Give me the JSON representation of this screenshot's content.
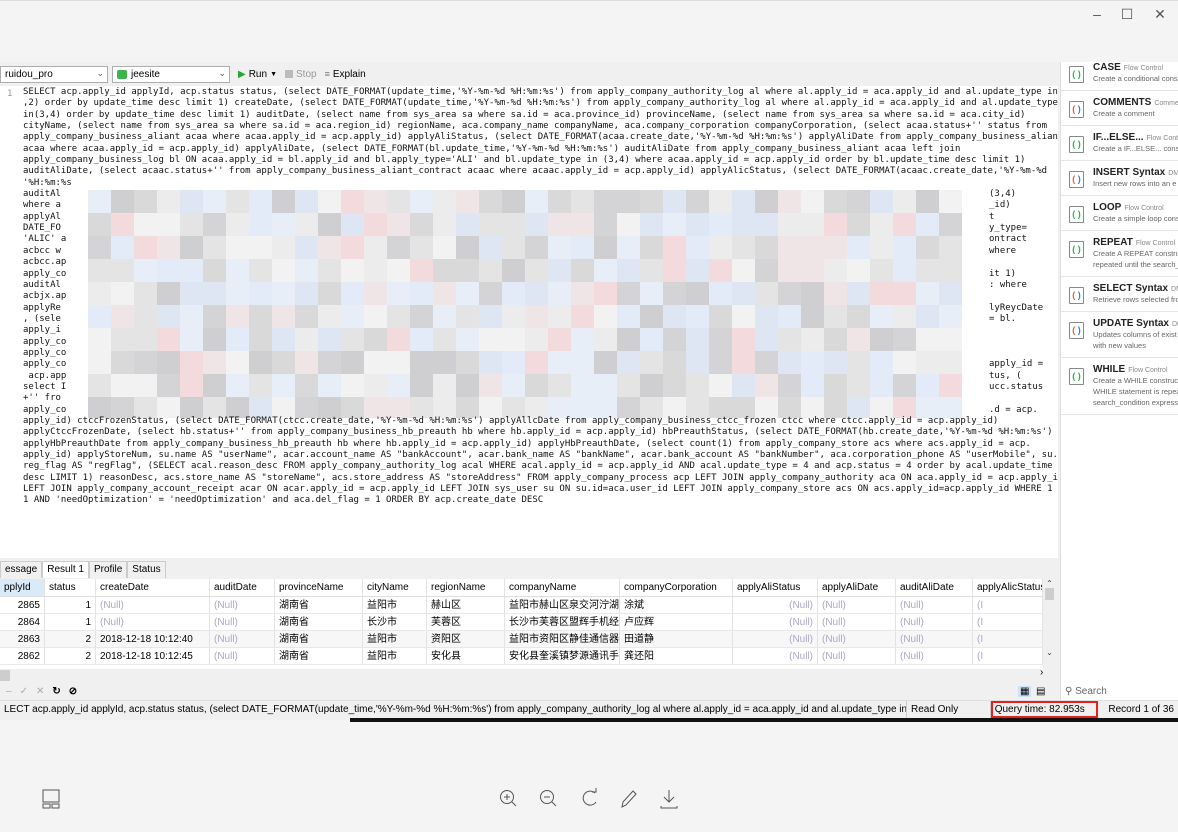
{
  "window": {
    "controls": [
      "minimize",
      "maximize",
      "close"
    ]
  },
  "toolbar": {
    "connection": "ruidou_pro",
    "database": "jeesite",
    "run": "Run",
    "stop": "Stop",
    "explain": "Explain"
  },
  "editor": {
    "line_number": "1",
    "full_lines_top": [
      "SELECT acp.apply_id applyId, acp.status status, (select DATE_FORMAT(update_time,'%Y-%m-%d %H:%m:%s') from apply_company_authority_log al where al.apply_id = aca.apply_id and al.update_type in(1",
      ",2) order by update_time desc limit 1) createDate, (select DATE_FORMAT(update_time,'%Y-%m-%d %H:%m:%s') from apply_company_authority_log al where al.apply_id = aca.apply_id and al.update_type",
      "in(3,4) order by update_time desc limit 1) auditDate, (select name from sys_area sa where sa.id = aca.province_id) provinceName, (select name from sys_area sa where sa.id = aca.city_id)",
      "cityName, (select name from sys_area sa where sa.id = aca.region_id) regionName, aca.company_name companyName, aca.company_corporation companyCorporation, (select acaa.status+'' status from",
      "apply_company_business_aliant acaa where acaa.apply_id = acp.apply_id) applyAliStatus, (select DATE_FORMAT(acaa.create_date,'%Y-%m-%d %H:%m:%s') applyAliDate from apply_company_business_aliant",
      "acaa where acaa.apply_id = acp.apply_id) applyAliDate, (select DATE_FORMAT(bl.update_time,'%Y-%m-%d %H:%m:%s') auditAliDate from apply_company_business_aliant acaa left join",
      "apply_company_business_log bl ON acaa.apply_id = bl.apply_id and bl.apply_type='ALI' and bl.update_type in (3,4) where acaa.apply_id = acp.apply_id order by bl.update_time desc limit 1)",
      "auditAliDate, (select acaac.status+'' from apply_company_business_aliant_contract acaac where acaac.apply_id = acp.apply_id) applyAlicStatus, (select DATE_FORMAT(acaac.create_date,'%Y-%m-%d"
    ],
    "blurred_lines": [
      {
        "left": "'%H:%m:%s",
        "right": ""
      },
      {
        "left": "auditAl",
        "right": "(3,4)"
      },
      {
        "left": "where a",
        "right": "_id)"
      },
      {
        "left": "applyAl",
        "right": "t"
      },
      {
        "left": "DATE_FO",
        "right": "y_type="
      },
      {
        "left": "'ALIC' a",
        "right": "ontract"
      },
      {
        "left": "acbcc w",
        "right": "where"
      },
      {
        "left": "acbcc.ap",
        "right": ""
      },
      {
        "left": "apply_co",
        "right": "it 1)"
      },
      {
        "left": "auditAl",
        "right": ": where"
      },
      {
        "left": "acbjx.ap",
        "right": ""
      },
      {
        "left": "applyRe",
        "right": "lyReycDate"
      },
      {
        "left": ", (sele",
        "right": "= bl."
      },
      {
        "left": "apply_i",
        "right": ""
      },
      {
        "left": "apply_co",
        "right": ""
      },
      {
        "left": "apply_co",
        "right": ""
      },
      {
        "left": "apply_co",
        "right": "apply_id ="
      },
      {
        "left": " acp.app",
        "right": "tus, ("
      },
      {
        "left": "select I",
        "right": "ucc.status"
      },
      {
        "left": "+'' fro",
        "right": ""
      },
      {
        "left": "apply_co",
        "right": ".d = acp."
      }
    ],
    "full_lines_bottom": [
      "apply_id) ctccFrozenStatus, (select DATE_FORMAT(ctcc.create_date,'%Y-%m-%d %H:%m:%s') applyAllcDate from apply_company_business_ctcc_frozen ctcc where ctcc.apply_id = acp.apply_id)",
      "applyCtccFrozenDate, (select hb.status+'' from apply_company_business_hb_preauth hb where hb.apply_id = acp.apply_id) hbPreauthStatus, (select DATE_FORMAT(hb.create_date,'%Y-%m-%d %H:%m:%s')",
      "applyHbPreauthDate from apply_company_business_hb_preauth hb where hb.apply_id = acp.apply_id) applyHbPreauthDate, (select count(1) from apply_company_store acs where acs.apply_id = acp.",
      "apply_id) applyStoreNum, su.name AS \"userName\", acar.account_name AS \"bankAccount\", acar.bank_name AS \"bankName\", acar.bank_account AS \"bankNumber\", aca.corporation_phone AS \"userMobile\", su.",
      "reg_flag AS \"regFlag\", (SELECT acal.reason_desc FROM apply_company_authority_log acal WHERE acal.apply_id = acp.apply_id AND acal.update_type = 4 and acp.status = 4 order by acal.update_time",
      "desc LIMIT 1) reasonDesc, acs.store_name AS \"storeName\", acs.store_address AS \"storeAddress\" FROM apply_company_process acp LEFT JOIN apply_company_authority aca ON aca.apply_id = acp.apply_id",
      "LEFT JOIN apply_company_account_receipt acar ON acar.apply_id = acp.apply_id LEFT JOIN sys_user su ON su.id=aca.user_id LEFT JOIN apply_company_store acs ON acs.apply_id=acp.apply_id WHERE 1 =",
      "1 AND 'needOptimization' = 'needOptimization' and aca.del_flag = 1 ORDER BY acp.create_date DESC"
    ]
  },
  "colors": {
    "keyword": "#2b7ff0",
    "string": "#e8254c",
    "number": "#27b53e",
    "highlight_box": "#e5201f"
  },
  "snippets": [
    {
      "title": "CASE",
      "category": "Flow Control",
      "desc": [
        "Create a conditional cons"
      ],
      "icon": "green"
    },
    {
      "title": "COMMENTS",
      "category": "Comme",
      "desc": [
        "Create a comment"
      ],
      "icon": "multi"
    },
    {
      "title": "IF...ELSE...",
      "category": "Flow Contro",
      "desc": [
        "Create a IF...ELSE... constru"
      ],
      "icon": "green"
    },
    {
      "title": "INSERT Syntax",
      "category": "DMI",
      "desc": [
        "Insert new rows into an e"
      ],
      "icon": "multi"
    },
    {
      "title": "LOOP",
      "category": "Flow Control",
      "desc": [
        "Create a simple loop cons"
      ],
      "icon": "green"
    },
    {
      "title": "REPEAT",
      "category": "Flow Control",
      "desc": [
        "Create A REPEAT construc",
        "repeated until the search_"
      ],
      "icon": "green"
    },
    {
      "title": "SELECT Syntax",
      "category": "DMI",
      "desc": [
        "Retrieve rows selected fro"
      ],
      "icon": "multi"
    },
    {
      "title": "UPDATE Syntax",
      "category": "DM",
      "desc": [
        "Updates columns of exist",
        "with new values"
      ],
      "icon": "multi"
    },
    {
      "title": "WHILE",
      "category": "Flow Control",
      "desc": [
        "Create a WHILE construct",
        "WHILE statement is repea",
        "search_condition expressi"
      ],
      "icon": "green"
    }
  ],
  "panel_search": "Search",
  "result_tabs": [
    {
      "label": "essage"
    },
    {
      "label": "Result 1",
      "active": true
    },
    {
      "label": "Profile"
    },
    {
      "label": "Status"
    }
  ],
  "grid": {
    "columns": [
      "pplyId",
      "status",
      "createDate",
      "auditDate",
      "provinceName",
      "cityName",
      "regionName",
      "companyName",
      "companyCorporation",
      "applyAliStatus",
      "applyAliDate",
      "auditAliDate",
      "applyAlicStatus"
    ],
    "rows": [
      [
        "2865",
        "1",
        "(Null)",
        "(Null)",
        "湖南省",
        "益阳市",
        "赫山区",
        "益阳市赫山区泉交河泞湖手机",
        "涂斌",
        "(Null)",
        "(Null)",
        "(Null)",
        "(I"
      ],
      [
        "2864",
        "1",
        "(Null)",
        "(Null)",
        "湖南省",
        "长沙市",
        "芙蓉区",
        "长沙市芙蓉区盟辉手机经营部",
        "卢应辉",
        "(Null)",
        "(Null)",
        "(Null)",
        "(I"
      ],
      [
        "2863",
        "2",
        "2018-12-18 10:12:40",
        "(Null)",
        "湖南省",
        "益阳市",
        "资阳区",
        "益阳市资阳区静佳通信器材经",
        "田道静",
        "(Null)",
        "(Null)",
        "(Null)",
        "(I"
      ],
      [
        "2862",
        "2",
        "2018-12-18 10:12:45",
        "(Null)",
        "湖南省",
        "益阳市",
        "安化县",
        "安化县奎溪镇梦源通讯手机卖",
        "龚还阳",
        "(Null)",
        "(Null)",
        "(Null)",
        "(I"
      ]
    ]
  },
  "status": {
    "sql": "LECT acp.apply_id applyId, acp.status status, (select DATE_FORMAT(update_time,'%Y-%m-%d %H:%m:%s') from apply_company_authority_log al where al.apply_id = aca.apply_id and al.update_type in(1,2) order by",
    "mode": "Read Only",
    "query_time": "Query time: 82.953s",
    "record": "Record 1 of 36"
  }
}
